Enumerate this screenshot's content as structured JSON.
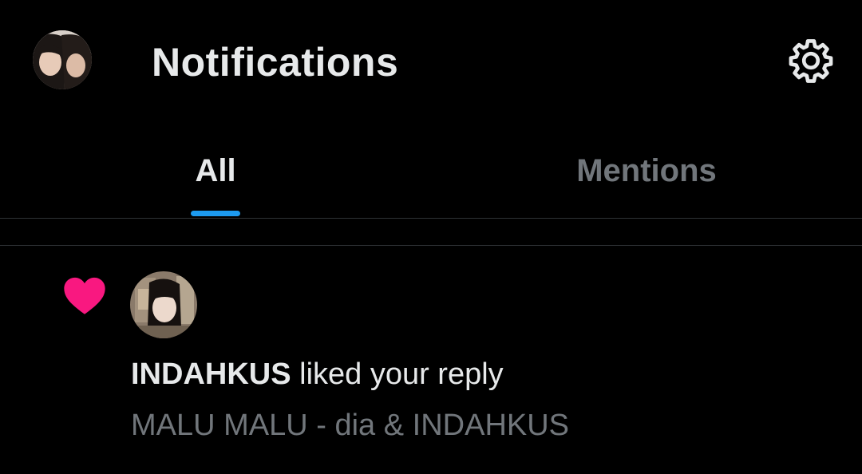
{
  "header": {
    "title": "Notifications",
    "avatar_icon": "profile-photo",
    "settings_icon": "gear-icon"
  },
  "tabs": [
    {
      "label": "All",
      "active": true
    },
    {
      "label": "Mentions",
      "active": false
    }
  ],
  "notifications": [
    {
      "type_icon": "heart-icon",
      "avatar_icon": "profile-photo",
      "user": "INDAHKUS",
      "action": " liked your reply",
      "snippet": "MALU MALU - dia & INDAHKUS"
    }
  ],
  "colors": {
    "background": "#000000",
    "text_primary": "#e7e9ea",
    "text_secondary": "#71767b",
    "accent": "#1d9bf0",
    "like": "#f91880",
    "divider": "#2f3336"
  }
}
